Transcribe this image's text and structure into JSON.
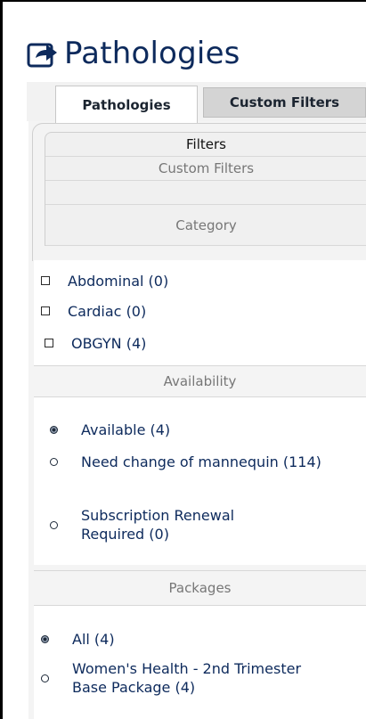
{
  "header": {
    "title": "Pathologies",
    "icon": "share-export-icon"
  },
  "tabs": [
    {
      "label": "Pathologies",
      "active": true
    },
    {
      "label": "Custom Filters",
      "active": false
    }
  ],
  "filters": {
    "title": "Filters",
    "custom_filters": "Custom Filters",
    "category_header": "Category"
  },
  "categories": [
    {
      "label": "Abdominal (0)",
      "checked": false
    },
    {
      "label": "Cardiac (0)",
      "checked": false
    },
    {
      "label": "OBGYN (4)",
      "checked": false
    }
  ],
  "availability": {
    "header": "Availability",
    "options": [
      {
        "label": "Available (4)",
        "checked": true
      },
      {
        "label": "Need change of mannequin (114)",
        "checked": false
      },
      {
        "label": "Subscription Renewal Required (0)",
        "checked": false
      }
    ]
  },
  "packages": {
    "header": "Packages",
    "options": [
      {
        "label": "All (4)",
        "checked": true
      },
      {
        "label": "Women's Health - 2nd Trimester Base Package (4)",
        "checked": false
      }
    ]
  }
}
